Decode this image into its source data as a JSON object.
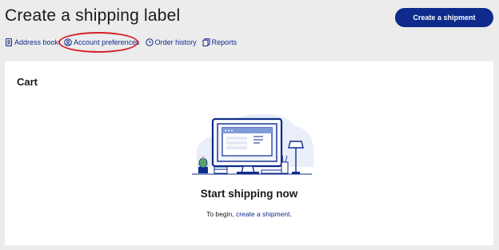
{
  "header": {
    "title": "Create a shipping label",
    "create_button": "Create a shipment"
  },
  "nav": {
    "items": [
      {
        "label": "Address book",
        "icon": "address-book-icon"
      },
      {
        "label": "Account preferences",
        "icon": "account-icon"
      },
      {
        "label": "Order history",
        "icon": "clock-icon"
      },
      {
        "label": "Reports",
        "icon": "reports-icon"
      }
    ]
  },
  "annotation": {
    "color": "#d41f26"
  },
  "cart": {
    "title": "Cart",
    "empty_title": "Start shipping now",
    "empty_prefix": "To begin, ",
    "empty_link": "create a shipment",
    "empty_suffix": "."
  },
  "colors": {
    "brand": "#0e2b8c",
    "background": "#ececec",
    "card": "#ffffff"
  }
}
